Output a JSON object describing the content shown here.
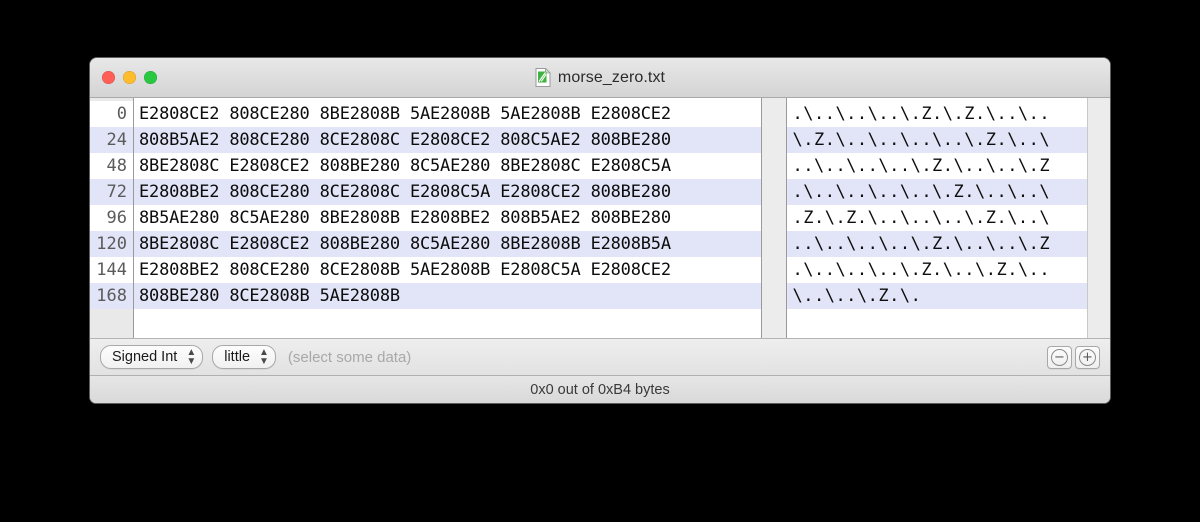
{
  "window": {
    "title": "morse_zero.txt",
    "icon": "text-document-icon",
    "traffic_lights": {
      "close": "close-button",
      "minimize": "minimize-button",
      "maximize": "maximize-button"
    },
    "colors": {
      "close": "#ff5f57",
      "minimize": "#ffbd2e",
      "maximize": "#28c840",
      "row_stripe": "#e2e4f7",
      "row_base": "#ffffff",
      "chrome": "#ececec"
    }
  },
  "editor": {
    "offsets": [
      "0",
      "24",
      "48",
      "72",
      "96",
      "120",
      "144",
      "168"
    ],
    "hex_rows": [
      "E2808CE2 808CE280 8BE2808B 5AE2808B 5AE2808B E2808CE2",
      "808B5AE2 808CE280 8CE2808C E2808CE2 808C5AE2 808BE280",
      "8BE2808C E2808CE2 808BE280 8C5AE280 8BE2808C E2808C5A",
      "E2808BE2 808CE280 8CE2808C E2808C5A E2808CE2 808BE280",
      "8B5AE280 8C5AE280 8BE2808B E2808BE2 808B5AE2 808BE280",
      "8BE2808C E2808CE2 808BE280 8C5AE280 8BE2808B E2808B5A",
      "E2808BE2 808CE280 8CE2808B 5AE2808B E2808C5A E2808CE2",
      "808BE280 8CE2808B 5AE2808B"
    ],
    "ascii_rows": [
      ".\\..\\..\\..\\.Z.\\.Z.\\..\\..",
      "\\.Z.\\..\\..\\..\\..\\.Z.\\..\\",
      "..\\..\\..\\..\\.Z.\\..\\..\\.Z",
      ".\\..\\..\\..\\..\\.Z.\\..\\..\\",
      ".Z.\\.Z.\\..\\..\\..\\.Z.\\..\\",
      "..\\..\\..\\..\\.Z.\\..\\..\\.Z",
      ".\\..\\..\\..\\.Z.\\..\\.Z.\\..",
      "\\..\\..\\.Z.\\."
    ]
  },
  "toolbar": {
    "type_popup": {
      "label": "Signed Int",
      "name": "data-type-popup"
    },
    "endian_popup": {
      "label": "little",
      "name": "endianness-popup"
    },
    "hint": "(select some data)",
    "minus_label": "−",
    "plus_label": "+"
  },
  "status": {
    "text": "0x0 out of 0xB4 bytes"
  }
}
